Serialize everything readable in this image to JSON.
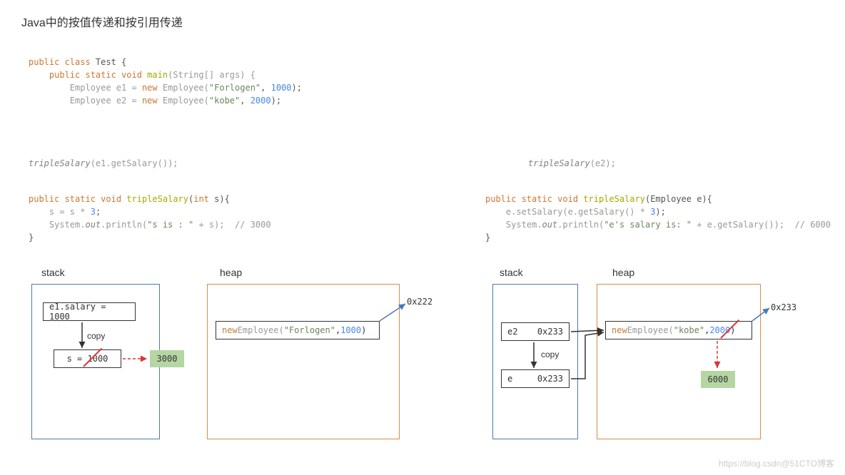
{
  "title": "Java中的按值传递和按引用传递",
  "code_top": {
    "l1": "public class ",
    "l1b": "Test {",
    "l2a": "    public static void ",
    "l2b": "main",
    "l2c": "(String[] args) {",
    "l3a": "        Employee e1 = ",
    "l3b": "new ",
    "l3c": "Employee(",
    "l3d": "\"Forlogen\"",
    "l3e": ", ",
    "l3f": "1000",
    "l3g": ");",
    "l4a": "        Employee e2 = ",
    "l4b": "new ",
    "l4c": "Employee(",
    "l4d": "\"kobe\"",
    "l4e": ", ",
    "l4f": "2000",
    "l4g": ");"
  },
  "call_left": "tripleSalary",
  "call_left_arg": "(e1.getSalary());",
  "call_right": "tripleSalary",
  "call_right_arg": "(e2);",
  "method_left": {
    "l1a": "public static void ",
    "l1b": "tripleSalary",
    "l1c": "(",
    "l1d": "int ",
    "l1e": "s){",
    "l2": "    s = s * ",
    "l2b": "3",
    "l2c": ";",
    "l3a": "    System.",
    "l3b": "out",
    "l3c": ".println(",
    "l3d": "\"s is : \"",
    "l3e": " + s);  ",
    "l3f": "// 3000",
    "l4": "}"
  },
  "method_right": {
    "l1a": "public static void ",
    "l1b": "tripleSalary",
    "l1c": "(Employee e){",
    "l2a": "    e.setSalary(e.getSalary() * ",
    "l2b": "3",
    "l2c": ");",
    "l3a": "    System.",
    "l3b": "out",
    "l3c": ".println(",
    "l3d": "\"e's salary is: \"",
    "l3e": " + e.getSalary());  ",
    "l3f": "// 6000",
    "l4": "}"
  },
  "labels": {
    "stack": "stack",
    "heap": "heap",
    "copy": "copy"
  },
  "left_diagram": {
    "cell1": "e1.salary = 1000",
    "cell2": "s = 1000",
    "green": "3000",
    "heap_new": "new ",
    "heap_emp": "Employee(",
    "heap_str": "\"Forlogen\"",
    "heap_comma": ", ",
    "heap_num": "1000",
    "heap_end": ")",
    "addr": "0x222"
  },
  "right_diagram": {
    "cell1a": "e2",
    "cell1b": "0x233",
    "cell2a": "e",
    "cell2b": "0x233",
    "heap_new": "new ",
    "heap_emp": "Employee(",
    "heap_str": "\"kobe\"",
    "heap_comma": ", ",
    "heap_num": "2000",
    "heap_end": ")",
    "green": "6000",
    "addr": "0x233"
  },
  "watermark": "https://blog.csdn@51CTO博客"
}
